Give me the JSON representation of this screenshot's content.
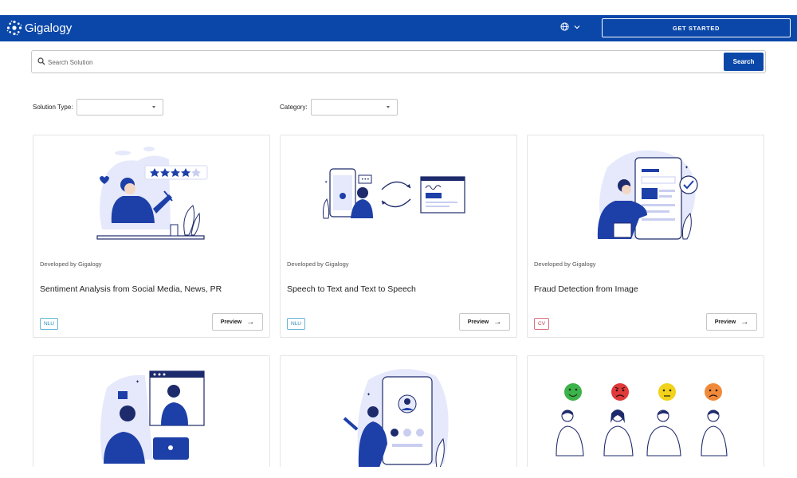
{
  "header": {
    "brand": "Gigalogy",
    "get_started_label": "GET STARTED",
    "colors": {
      "navbar": "#0a47a9",
      "accent": "#0a47a9"
    }
  },
  "search": {
    "placeholder": "Search Solution",
    "value": "",
    "button_label": "Search"
  },
  "filters": {
    "solution_type": {
      "label": "Solution Type:",
      "selected": ""
    },
    "category": {
      "label": "Category:",
      "selected": ""
    }
  },
  "cards": [
    {
      "developer": "Developed by Gigalogy",
      "title": "Sentiment Analysis from Social Media, News, PR",
      "tag": "NLU",
      "preview_label": "Preview",
      "illustration": "sentiment-rating-illustration"
    },
    {
      "developer": "Developed by Gigalogy",
      "title": "Speech to Text and Text to Speech",
      "tag": "NLU",
      "preview_label": "Preview",
      "illustration": "speech-text-illustration"
    },
    {
      "developer": "Developed by Gigalogy",
      "title": "Fraud Detection from Image",
      "tag": "CV",
      "preview_label": "Preview",
      "illustration": "fraud-detection-illustration"
    }
  ],
  "cards_row2": [
    {
      "illustration": "video-call-like-illustration"
    },
    {
      "illustration": "mobile-profile-illustration"
    },
    {
      "illustration": "emotion-faces-illustration"
    }
  ]
}
